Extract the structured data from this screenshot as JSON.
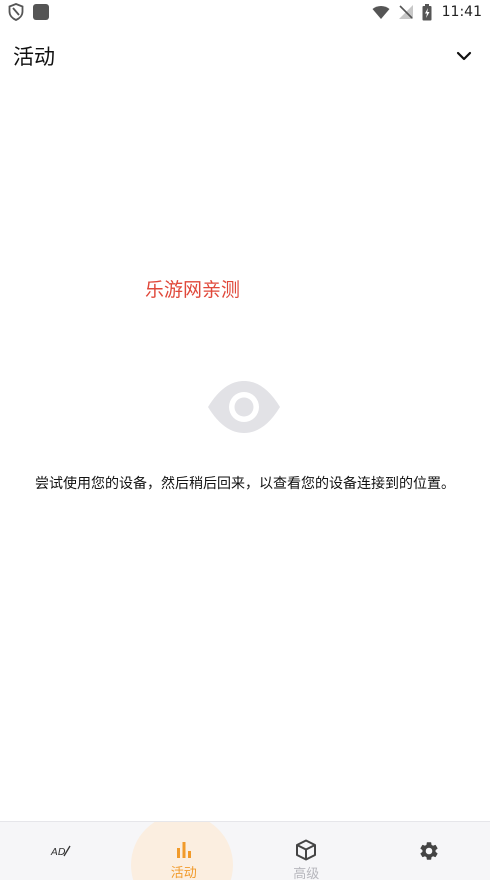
{
  "status_bar": {
    "time": "11:41",
    "icons_left": [
      "shield-icon",
      "app-square-icon"
    ],
    "icons_right": [
      "wifi-icon",
      "no-signal-icon",
      "battery-charging-icon"
    ]
  },
  "app_bar": {
    "title": "活动",
    "dropdown_icon": "chevron-down-icon"
  },
  "watermark": "乐游网亲测",
  "empty_state": {
    "icon": "eye-icon",
    "message": "尝试使用您的设备，然后稍后回来，以查看您的设备连接到的位置。"
  },
  "bottom_nav": {
    "items": [
      {
        "icon": "ad-block-icon",
        "label": "",
        "active": false
      },
      {
        "icon": "bar-chart-icon",
        "label": "活动",
        "active": true
      },
      {
        "icon": "cube-icon",
        "label": "高级",
        "active": false
      },
      {
        "icon": "gear-icon",
        "label": "",
        "active": false
      }
    ]
  },
  "colors": {
    "accent": "#f19a2a",
    "accent_bg": "#fbeee0",
    "watermark": "#e0483a",
    "eye_gray": "#e2e2e6",
    "nav_bg": "#f6f6f8"
  }
}
